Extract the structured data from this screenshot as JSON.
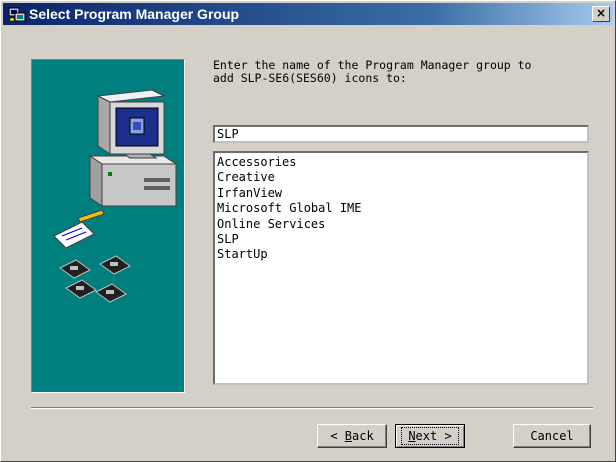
{
  "window": {
    "title": "Select Program Manager Group",
    "close_label": "×"
  },
  "prompt": "Enter the name of the Program Manager group to\nadd SLP-SE6(SES60) icons to:",
  "group_input": {
    "value": "SLP"
  },
  "groups": [
    "Accessories",
    "Creative",
    "IrfanView",
    "Microsoft Global IME",
    "Online Services",
    "SLP",
    "StartUp"
  ],
  "buttons": {
    "back_key": "B",
    "back_rest": "ack",
    "back_prefix": "< ",
    "next_key": "N",
    "next_rest": "ext >",
    "cancel": "Cancel"
  },
  "colors": {
    "title_start": "#0a246a",
    "title_end": "#a6caf0",
    "art_bg": "#007f7f",
    "face": "#d4d0c8"
  },
  "icons": [
    "setup-app-icon",
    "computer-icon",
    "floppy-disk-icon",
    "close-icon"
  ]
}
